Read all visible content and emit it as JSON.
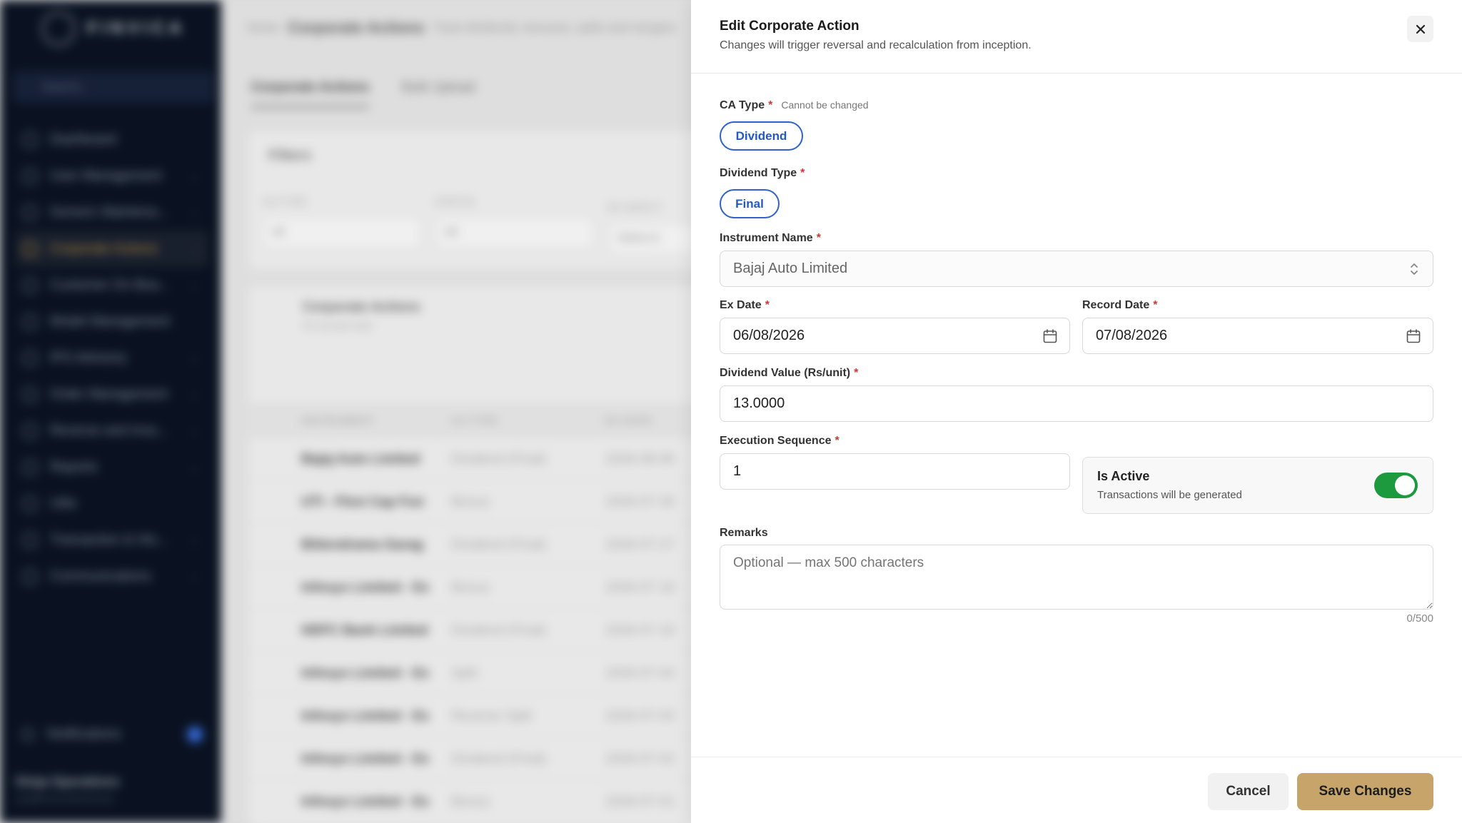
{
  "background": {
    "logo": "FINVICA",
    "search_placeholder": "Search...",
    "nav": [
      {
        "label": "Dashboard"
      },
      {
        "label": "User Management"
      },
      {
        "label": "Generic Maintena..."
      },
      {
        "label": "Corporate Actions"
      },
      {
        "label": "Customer On Boa..."
      },
      {
        "label": "Model Management"
      },
      {
        "label": "IPS Advisory"
      },
      {
        "label": "Order Management"
      },
      {
        "label": "Reverse and Inva..."
      },
      {
        "label": "Reports"
      },
      {
        "label": "Utils"
      },
      {
        "label": "Transaction & His..."
      },
      {
        "label": "Communications"
      }
    ],
    "notifications_label": "Notifications",
    "user_name": "Ginja Operations",
    "user_email": "ops@finvica.internal.local",
    "breadcrumb": {
      "home": "Home",
      "current": "Corporate Actions",
      "desc": "Track dividends, bonuses, splits and mergers"
    },
    "tabs": [
      "Corporate Actions",
      "Bulk Upload"
    ],
    "filters_title": "Filters",
    "filter_cols": [
      {
        "label": "CA TYPE",
        "value": "All"
      },
      {
        "label": "STATUS",
        "value": "All"
      },
      {
        "label": "EX DATE F",
        "value": "Select d"
      }
    ],
    "table_title": "Corporate Actions",
    "table_sub": "45 records total",
    "table_headers": [
      "INSTRUMENT",
      "CA TYPE",
      "EX DATE"
    ],
    "rows": [
      [
        "Bajaj Auto Limited",
        "Dividend (Final)",
        "2026-08-06"
      ],
      [
        "UTI - Flexi Cap Fun",
        "Bonus",
        "2026-07-30"
      ],
      [
        "Bittendrama Garag",
        "Dividend (Final)",
        "2026-07-27"
      ],
      [
        "Infosys Limited - Ex",
        "Bonus",
        "2026-07-18"
      ],
      [
        "HDFC Bank Limited",
        "Dividend (Final)",
        "2026-07-18"
      ],
      [
        "Infosys Limited - Ex",
        "Split",
        "2026-07-04"
      ],
      [
        "Infosys Limited - Ex",
        "Reverse Split",
        "2026-07-03"
      ],
      [
        "Infosys Limited - Ex",
        "Dividend (Final)",
        "2026-07-02"
      ],
      [
        "Infosys Limited - Ex",
        "Bonus",
        "2026-07-01"
      ]
    ]
  },
  "drawer": {
    "title": "Edit Corporate Action",
    "subtitle": "Changes will trigger reversal and recalculation from inception.",
    "ca_type": {
      "label": "CA Type",
      "note": "Cannot be changed",
      "value": "Dividend"
    },
    "dividend_type": {
      "label": "Dividend Type",
      "value": "Final"
    },
    "instrument": {
      "label": "Instrument Name",
      "value": "Bajaj Auto Limited"
    },
    "ex_date": {
      "label": "Ex Date",
      "value": "06/08/2026"
    },
    "record_date": {
      "label": "Record Date",
      "value": "07/08/2026"
    },
    "dividend_value": {
      "label": "Dividend Value (Rs/unit)",
      "value": "13.0000"
    },
    "exec_seq": {
      "label": "Execution Sequence",
      "value": "1"
    },
    "is_active": {
      "title": "Is Active",
      "subtitle": "Transactions will be generated",
      "on": true
    },
    "remarks": {
      "label": "Remarks",
      "placeholder": "Optional — max 500 characters",
      "counter": "0/500"
    },
    "required_mark": "*",
    "cancel_label": "Cancel",
    "save_label": "Save Changes"
  },
  "colors": {
    "accent_blue": "#2f63c9",
    "toggle_green": "#1e9a3e",
    "save_gold": "#c7a46a",
    "sidebar_bg": "#0b1424"
  }
}
